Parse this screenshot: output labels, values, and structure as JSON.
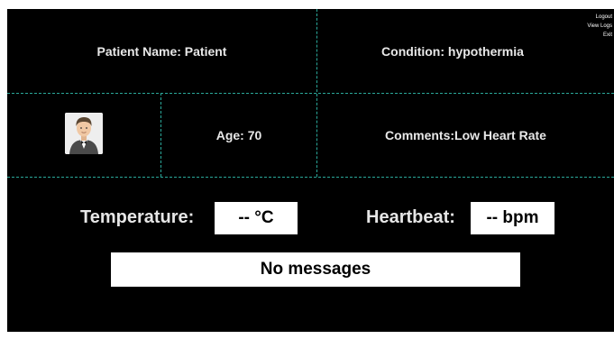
{
  "patient": {
    "name_label": "Patient Name: Patient",
    "condition_label": "Condition: hypothermia",
    "age_label": "Age: 70",
    "comments_label": "Comments:Low Heart Rate"
  },
  "menu": {
    "items": [
      "Logout",
      "View Logs",
      "Exit"
    ]
  },
  "vitals": {
    "temperature_label": "Temperature:",
    "temperature_value": "-- °C",
    "heartbeat_label": "Heartbeat:",
    "heartbeat_value": "-- bpm"
  },
  "messages": {
    "text": "No messages"
  },
  "colors": {
    "background": "#000000",
    "grid_line": "#2aa89a",
    "text": "#e8e8e8",
    "box": "#ffffff"
  },
  "icons": {
    "avatar": "patient-avatar-icon"
  }
}
